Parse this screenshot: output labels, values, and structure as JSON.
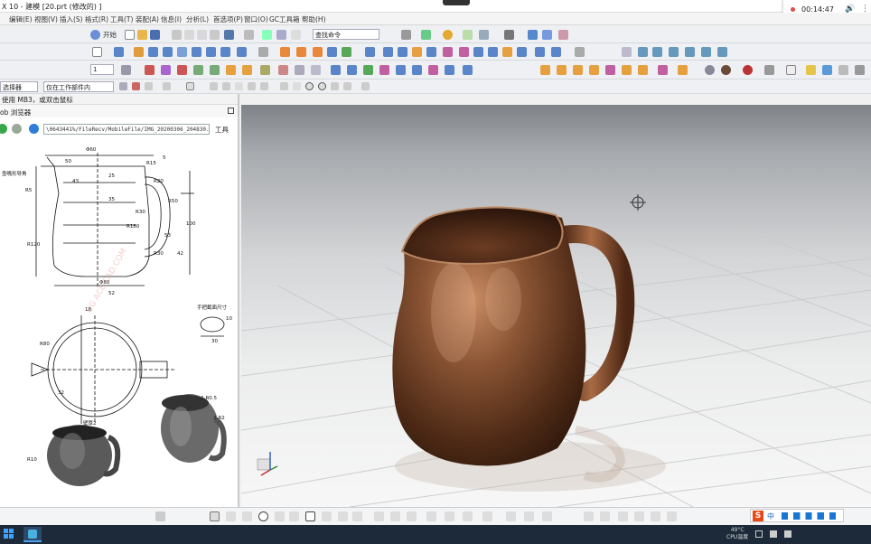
{
  "window": {
    "title": "X 10 - 建模   [20.prt  (修改的)  ]"
  },
  "recorder": {
    "time": "00:14:47"
  },
  "menubar": {
    "items": [
      "编辑(E)",
      "视图(V)",
      "插入(S)",
      "格式(R)",
      "工具(T)",
      "装配(A)",
      "信息(I)",
      "分析(L)",
      "首选项(P)",
      "窗口(O)",
      "GC工具箱",
      "帮助(H)"
    ]
  },
  "toolbar": {
    "start_label": "开始",
    "command_search_value": "查找命令",
    "layer_value": "1"
  },
  "selection_bar": {
    "filter_value": "选择器",
    "scope_value": "仅在工作部件内"
  },
  "browser": {
    "header": "ob 浏览器",
    "notice": "使用 MB3，或双击鼠标",
    "url_value": "\\0643441%/FileRecv/MobileFile/IMG_20200306_204830.jpg",
    "tools_label": "工具"
  },
  "drawing": {
    "dims": [
      "Φ60",
      "50",
      "25",
      "R15",
      "5",
      "R20",
      "R50",
      "35",
      "R30",
      "100",
      "R180",
      "R120",
      "R30",
      "Φ80",
      "52",
      "R5",
      "43",
      "53",
      "42",
      "18",
      "10",
      "30",
      "32",
      "R80",
      "R10"
    ],
    "labels": {
      "spout_note": "壶嘴形导角",
      "section_title": "手把截面尺寸",
      "round_note_1": "2-R0.5",
      "round_note_2": "2-R2",
      "thick_note": "壁厚2",
      "r10": "R10",
      "watermark": "UG ACE CAD.COM"
    }
  },
  "taskbar": {
    "temp": "49°C",
    "cpu_label": "CPU温度"
  },
  "ime": {
    "label": "中"
  },
  "colors": {
    "viewport_top": "#7f8288",
    "viewport_bottom": "#f7f7f7",
    "pitcher_brown": "#7a4a2c",
    "taskbar": "#1c2a3a"
  }
}
